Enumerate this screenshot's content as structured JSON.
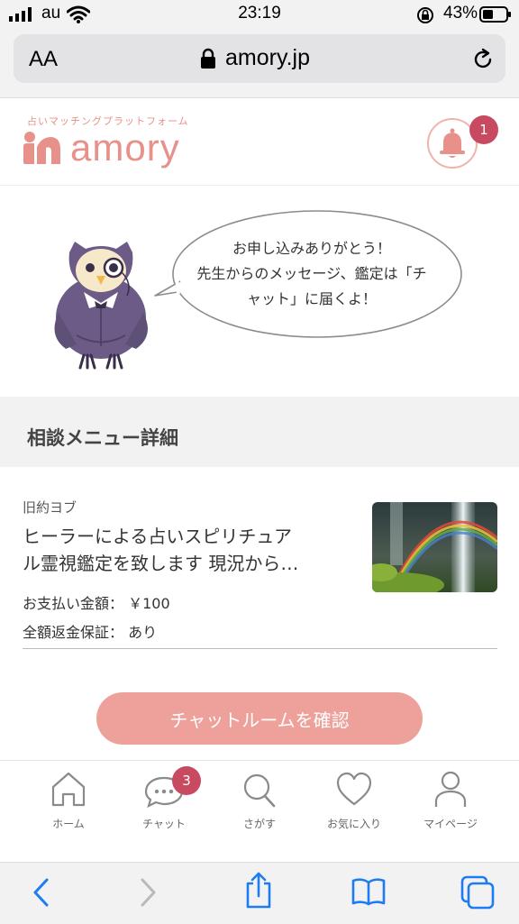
{
  "status_bar": {
    "carrier": "au",
    "time": "23:19",
    "battery": "43%"
  },
  "browser": {
    "text_size_label": "AA",
    "url": "amory.jp"
  },
  "site": {
    "tagline": "占いマッチングプラットフォーム",
    "brand": "amory",
    "notification_count": "1",
    "brand_color": "#e8918a",
    "badge_color": "#c84a60"
  },
  "message": {
    "line1": "お申し込みありがとう！",
    "line2": "先生からのメッセージ、鑑定は「チ",
    "line3": "ャット」に届くよ！"
  },
  "section": {
    "title": "相談メニュー詳細"
  },
  "menu": {
    "author": "旧約ヨブ",
    "title_line1": "ヒーラーによる占いスピリチュア",
    "title_line2": "ル霊視鑑定を致します 現況から…",
    "price": "お支払い金額： ￥100",
    "refund": "全額返金保証： あり"
  },
  "cta": {
    "label": "チャットルームを確認"
  },
  "nav": {
    "chat_badge": "3",
    "items": [
      {
        "label": "ホーム",
        "icon": "home-icon"
      },
      {
        "label": "チャット",
        "icon": "chat-icon"
      },
      {
        "label": "さがす",
        "icon": "search-icon"
      },
      {
        "label": "お気に入り",
        "icon": "heart-icon"
      },
      {
        "label": "マイページ",
        "icon": "person-icon"
      }
    ]
  }
}
